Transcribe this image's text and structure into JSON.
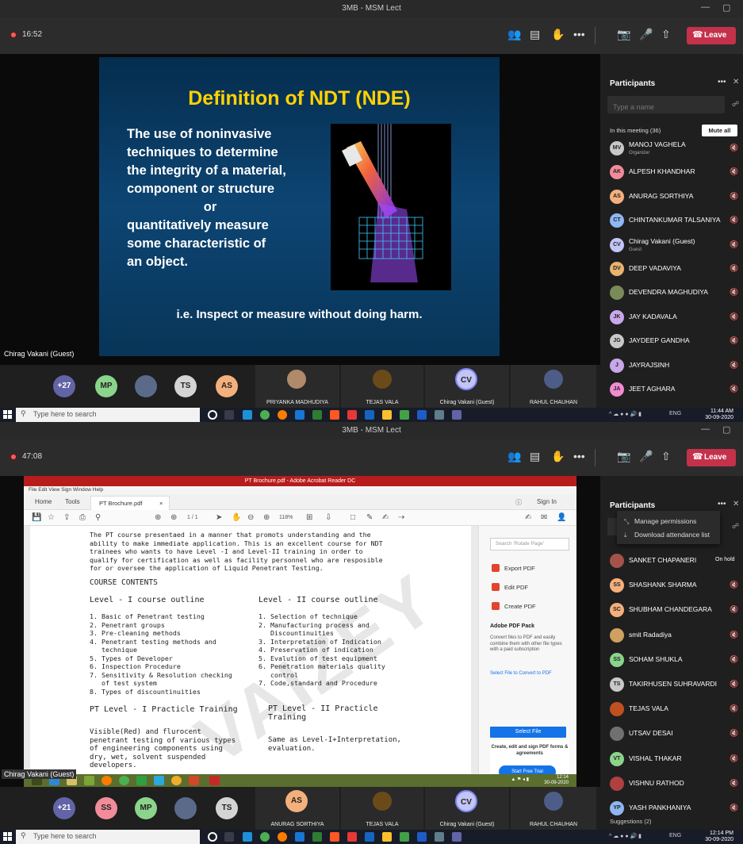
{
  "shot1": {
    "window_title": "3MB - MSM Lect",
    "timer": "16:52",
    "leave_label": "Leave",
    "slide": {
      "title": "Definition of NDT (NDE)",
      "lines": [
        "The use of noninvasive",
        "techniques to determine",
        "the integrity of a material,",
        "component or structure",
        "or",
        "quantitatively measure",
        "some characteristic of",
        "an object."
      ],
      "footer": "i.e. Inspect or measure without doing harm."
    },
    "speaker_tag": "Chirag Vakani (Guest)",
    "strip": {
      "overflow_count": "+27",
      "avatars": [
        {
          "initials": "MP",
          "color": "#8bd48b"
        },
        {
          "initials": "TS",
          "color": "#d4d4d4"
        },
        {
          "initials": "AS",
          "color": "#f4b07c"
        }
      ],
      "tiles": [
        {
          "name": "PRIYANKA MADHUDIYA"
        },
        {
          "name": "TEJAS VALA"
        },
        {
          "name": "Chirag Vakani (Guest)",
          "initials": "CV"
        },
        {
          "name": "RAHUL CHAUHAN"
        }
      ]
    },
    "panel": {
      "title": "Participants",
      "search_placeholder": "Type a name",
      "in_meeting": "In this meeting (36)",
      "mute_all": "Mute all",
      "people": [
        {
          "initials": "MV",
          "name": "MANOJ VAGHELA",
          "sub": "Organizer",
          "color": "#c8c8c8"
        },
        {
          "initials": "AK",
          "name": "ALPESH KHANDHAR",
          "color": "#f28b9a"
        },
        {
          "initials": "AS",
          "name": "ANURAG SORTHIYA",
          "color": "#f4b07c"
        },
        {
          "initials": "CT",
          "name": "CHINTANKUMAR TALSANIYA",
          "color": "#8fb7f2"
        },
        {
          "initials": "CV",
          "name": "Chirag Vakani (Guest)",
          "sub": "Guest",
          "color": "#c2c5f5"
        },
        {
          "initials": "DV",
          "name": "DEEP VADAVIYA",
          "color": "#e9b46f"
        },
        {
          "initials": "",
          "name": "DEVENDRA MAGHUDIYA",
          "color": "#7a8a58"
        },
        {
          "initials": "JK",
          "name": "JAY KADAVALA",
          "color": "#c8a8e8"
        },
        {
          "initials": "JG",
          "name": "JAYDEEP GANDHA",
          "color": "#c8c8c8"
        },
        {
          "initials": "J",
          "name": "JAYRAJSINH",
          "color": "#c8a8e8"
        },
        {
          "initials": "JA",
          "name": "JEET AGHARA",
          "color": "#f28bd0"
        }
      ]
    },
    "taskbar": {
      "search_placeholder": "Type here to search",
      "lang": "ENG",
      "time": "11:44 AM",
      "date": "30-09-2020"
    }
  },
  "shot2": {
    "window_title": "3MB - MSM Lect",
    "timer": "47:08",
    "leave_label": "Leave",
    "acrobat": {
      "title": "PT Brochure.pdf - Adobe Acrobat Reader DC",
      "menu": "File  Edit  View  Sign  Window  Help",
      "tab_home": "Home",
      "tab_tools": "Tools",
      "tab_doc": "PT Brochure.pdf",
      "sign_in": "Sign In",
      "page": "1 / 1",
      "zoom": "118%",
      "doc": {
        "intro": "The PT course presentaed in a manner that promots understanding and the\nability to make immediate application. This is an excellent course for NDT\ntrainees who wants to have Level -I and Level-II training in order to\nqualify for certification as well as facility personnel who are resposible\nfor or oversee the application of Liquid Penetrant Testing.",
        "contents_heading": "COURSE CONTENTS",
        "level1_heading": "Level  - I course outline",
        "level2_heading": "Level - II course outline",
        "level1_list": "1. Basic of Penetrant testing\n2. Penetrant groups\n3. Pre-cleaning methods\n4. Penetrant testing methods and\n   technique\n5. Types of Developer\n6. Inspection Procedure\n7. Sensitivity & Resolution checking\n   of test system\n8. Types of discountinuities",
        "level2_list": "1. Selection of technique\n2. Manufacturing process and\n   Discountinuities\n3. Interpretation of Indication\n4. Preservation of indication\n5. Evalution of test equipment\n6. Penetration materials quality\n   control\n7. Code,standard and Procedure",
        "practical1_heading": "PT Level - I Practicle Training",
        "practical2_heading": "PT Level - II Practicle\nTraining",
        "practical1_text": "Visible(Red) and flurocent\npenetrant testing of various types\nof engineering components using\ndry, wet, solvent suspended\ndevelopers.",
        "practical2_text": "Same as Level-I+Interpretation,\nevaluation.",
        "watermark": "VAIZEY"
      },
      "right_pane": {
        "search_placeholder": "Search 'Rotate Page'",
        "export_pdf": "Export PDF",
        "edit_pdf": "Edit PDF",
        "create_pdf": "Create PDF",
        "pack_title": "Adobe PDF Pack",
        "pack_text": "Convert files to PDF and easily combine them with other file types with a paid subscription",
        "select_convert": "Select File to Convert to PDF",
        "select_file": "Select File",
        "promo": "Create, edit and sign PDF forms & agreements",
        "trial": "Start Free Trial"
      },
      "vm_time": "12:14",
      "vm_date": "30-09-2020"
    },
    "speaker_tag": "Chirag Vakani (Guest)",
    "strip": {
      "overflow_count": "+21",
      "avatars": [
        {
          "initials": "SS",
          "color": "#f28b9a"
        },
        {
          "initials": "MP",
          "color": "#8bd48b"
        },
        {
          "initials": "TS",
          "color": "#d4d4d4"
        }
      ],
      "tiles": [
        {
          "name": "ANURAG SORTHIYA",
          "initials": "AS"
        },
        {
          "name": "TEJAS VALA"
        },
        {
          "name": "Chirag Vakani (Guest)",
          "initials": "CV"
        },
        {
          "name": "RAHUL CHAUHAN"
        }
      ]
    },
    "panel": {
      "title": "Participants",
      "menu_permissions": "Manage permissions",
      "menu_attendance": "Download attendance list",
      "people": [
        {
          "initials": "",
          "name": "SANKET CHAPANERI",
          "status": "On hold",
          "color": "#a5524a"
        },
        {
          "initials": "SS",
          "name": "SHASHANK SHARMA",
          "color": "#f4b07c"
        },
        {
          "initials": "SC",
          "name": "SHUBHAM CHANDEGARA",
          "color": "#f4b07c"
        },
        {
          "initials": "",
          "name": "smit Radadiya",
          "color": "#d0a060"
        },
        {
          "initials": "SS",
          "name": "SOHAM SHUKLA",
          "color": "#8bd48b"
        },
        {
          "initials": "TS",
          "name": "TAKIRHUSEN SUHRAVARDI",
          "color": "#c8c8c8"
        },
        {
          "initials": "",
          "name": "TEJAS VALA",
          "color": "#c05020"
        },
        {
          "initials": "",
          "name": "UTSAV DESAI",
          "color": "#707070"
        },
        {
          "initials": "VT",
          "name": "VISHAL THAKAR",
          "color": "#8bd48b"
        },
        {
          "initials": "",
          "name": "VISHNU RATHOD",
          "color": "#b04040"
        },
        {
          "initials": "YP",
          "name": "YASH PANKHANIYA",
          "color": "#8fb7f2"
        }
      ],
      "suggestions": "Suggestions (2)"
    },
    "taskbar": {
      "search_placeholder": "Type here to search",
      "lang": "ENG",
      "time": "12:14 PM",
      "date": "30-09-2020"
    }
  }
}
